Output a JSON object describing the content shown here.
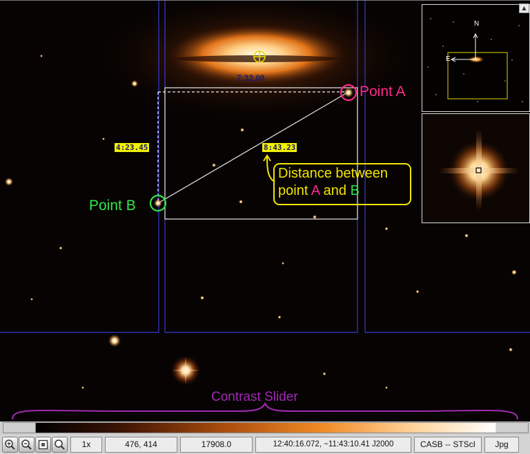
{
  "overlay": {
    "point_a_label": "Point A",
    "point_b_label": "Point B",
    "coord_top": "7:32.08",
    "coord_left": "4:23.45",
    "coord_diagonal": "8:43.23",
    "callout": {
      "line1": "Distance between",
      "line2_prefix": "point ",
      "line2_a": "A",
      "line2_mid": " and ",
      "line2_b": "B"
    },
    "contrast_label": "Contrast Slider"
  },
  "panner": {
    "north_label": "N",
    "east_label": "E"
  },
  "statusbar": {
    "zoom_level": "1x",
    "pixel_coords": "476, 414",
    "pixel_value": "17908.0",
    "sky_coords": "12:40:16.072, −11:43:10.41 J2000",
    "survey": "CASB -- STScI",
    "format": "Jpg"
  },
  "icons": {
    "zoom_in": "zoom-in-icon",
    "zoom_out": "zoom-out-icon",
    "zoom_fit": "zoom-fit-icon",
    "zoom_reset": "zoom-reset-icon"
  },
  "colors": {
    "point_a": "#ff2a8c",
    "point_b": "#2ee84a",
    "callout": "#f4e600",
    "contrast": "#a22ab5",
    "frame_lines": "#3b3bd0"
  }
}
